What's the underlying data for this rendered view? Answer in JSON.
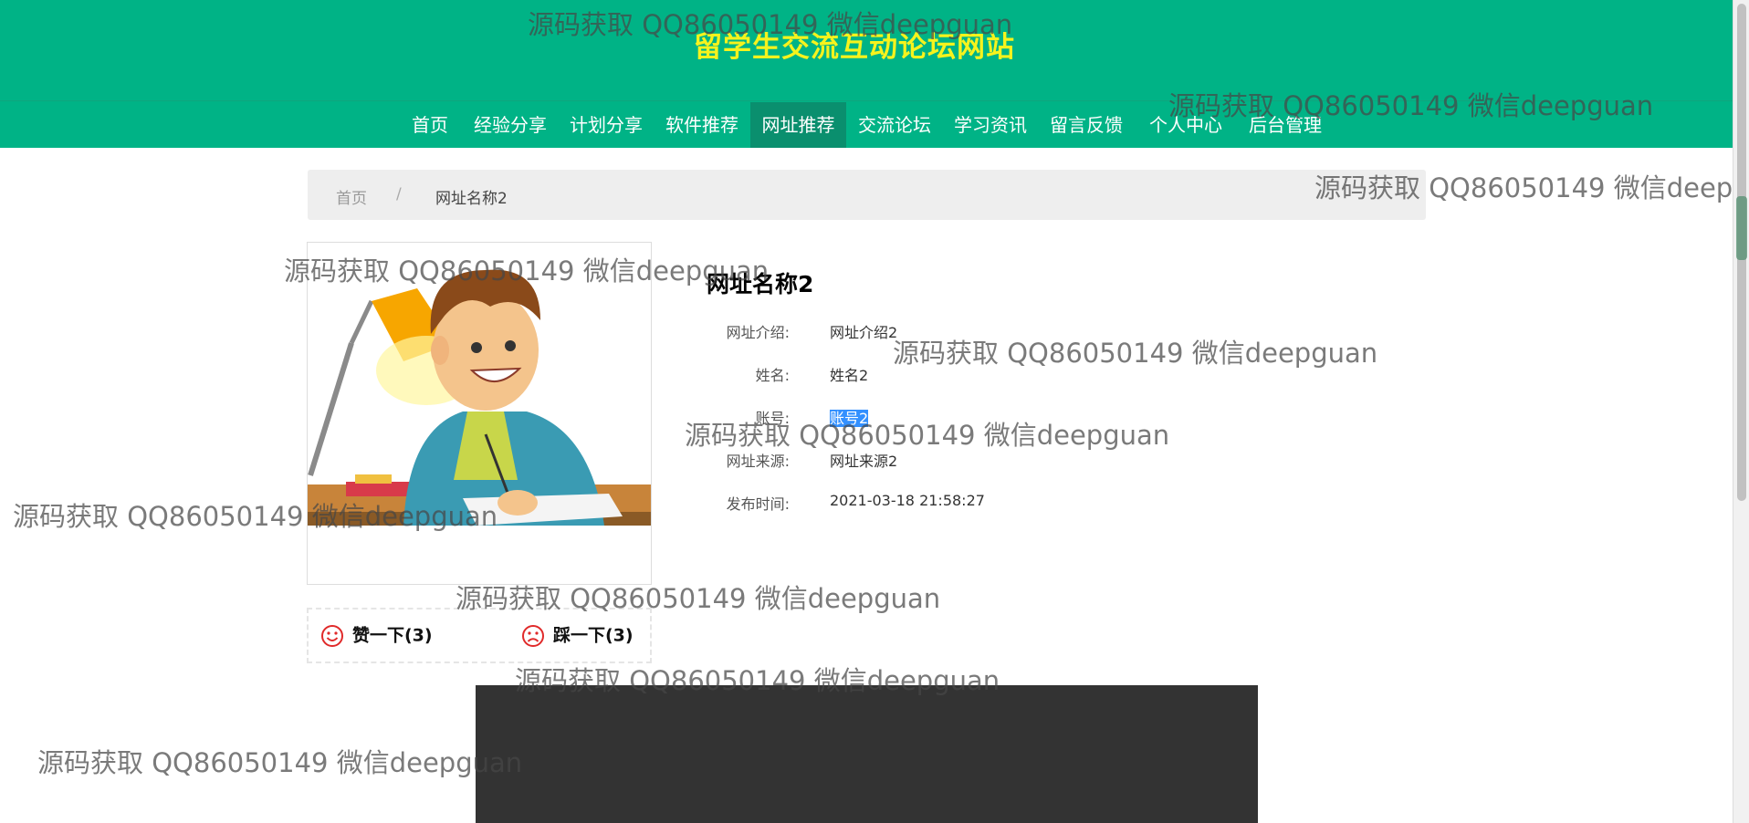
{
  "header": {
    "site_title": "留学生交流互动论坛网站",
    "nav": [
      {
        "label": "首页",
        "active": false
      },
      {
        "label": "经验分享",
        "active": false
      },
      {
        "label": "计划分享",
        "active": false
      },
      {
        "label": "软件推荐",
        "active": false
      },
      {
        "label": "网址推荐",
        "active": true
      },
      {
        "label": "交流论坛",
        "active": false
      },
      {
        "label": "学习资讯",
        "active": false
      },
      {
        "label": "留言反馈",
        "active": false
      },
      {
        "label": "个人中心",
        "active": false
      },
      {
        "label": "后台管理",
        "active": false
      }
    ]
  },
  "breadcrumb": {
    "home": "首页",
    "separator": "/",
    "current": "网址名称2"
  },
  "detail": {
    "title": "网址名称2",
    "fields": [
      {
        "label": "网址介绍:",
        "value": "网址介绍2"
      },
      {
        "label": "姓名:",
        "value": "姓名2"
      },
      {
        "label": "账号:",
        "value": "账号2"
      },
      {
        "label": "网址来源:",
        "value": "网址来源2"
      },
      {
        "label": "发布时间:",
        "value": "2021-03-18 21:58:27"
      }
    ]
  },
  "votes": {
    "like_label": "赞一下(3)",
    "dislike_label": "踩一下(3)"
  },
  "watermark": "源码获取 QQ86050149 微信deepguan",
  "colors": {
    "header": "#00b386",
    "title": "#f6f31d",
    "nav_active": "#0a8f6e",
    "vote_icon": "#e02a2a"
  },
  "icons": [
    "smile-icon",
    "frown-icon"
  ]
}
